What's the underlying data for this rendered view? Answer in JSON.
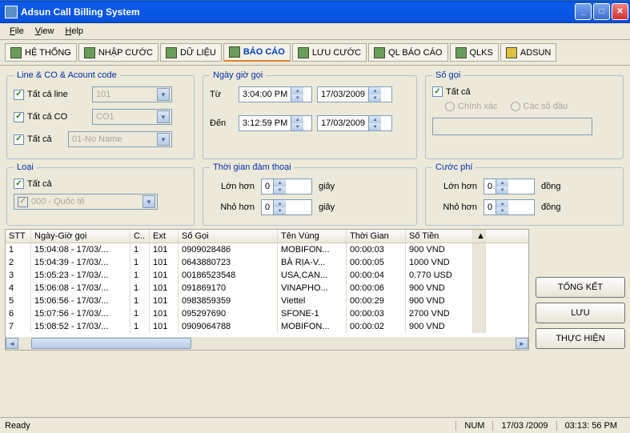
{
  "window": {
    "title": "Adsun Call Billing System"
  },
  "menu": {
    "file": "File",
    "view": "View",
    "help": "Help"
  },
  "tabs": [
    {
      "label": "HỆ THỐNG"
    },
    {
      "label": "NHẬP CƯỚC"
    },
    {
      "label": "DỮ LIỆU"
    },
    {
      "label": "BÁO CÁO"
    },
    {
      "label": "LƯU CƯỚC"
    },
    {
      "label": "QL BÁO CÁO"
    },
    {
      "label": "QLKS"
    },
    {
      "label": "ADSUN"
    }
  ],
  "group_lineco": {
    "legend": "Line & CO & Acount code",
    "all_line": "Tất cả line",
    "line_combo": "101",
    "all_co": "Tất cả CO",
    "co_combo": "CO1",
    "all_acc": "Tất cả",
    "acc_combo": "01-No Name"
  },
  "group_datetime": {
    "legend": "Ngày giờ gọi",
    "from": "Từ",
    "from_time": "3:04:00 PM",
    "from_date": "17/03/2009",
    "to": "Đến",
    "to_time": "3:12:59 PM",
    "to_date": "17/03/2009"
  },
  "group_number": {
    "legend": "Số gọi",
    "all": "Tất cả",
    "exact": "Chính xác",
    "prefix": "Các số đầu"
  },
  "group_type": {
    "legend": "Loại",
    "all": "Tất cả",
    "combo": "000 - Quốc tế"
  },
  "group_duration": {
    "legend": "Thời gian đàm thoại",
    "gt": "Lớn hơn",
    "lt": "Nhỏ hơn",
    "gt_val": "0",
    "lt_val": "0",
    "unit": "giây"
  },
  "group_cost": {
    "legend": "Cước phí",
    "gt": "Lớn hơn",
    "lt": "Nhỏ hơn",
    "gt_val": "0",
    "lt_val": "0",
    "unit": "đồng"
  },
  "table": {
    "headers": [
      "STT",
      "Ngày-Giờ gọi",
      "C..",
      "Ext",
      "Số Gọi",
      "Tên Vùng",
      "Thời Gian",
      "Số Tiền"
    ],
    "rows": [
      [
        "1",
        "15:04:08 - 17/03/...",
        "1",
        "101",
        "0909028486",
        "MOBIFON...",
        "00:00:03",
        "900 VND"
      ],
      [
        "2",
        "15:04:39 - 17/03/...",
        "1",
        "101",
        "0643880723",
        "BÀ RỊA-V...",
        "00:00:05",
        "1000 VND"
      ],
      [
        "3",
        "15:05:23 - 17/03/...",
        "1",
        "101",
        "00186523548",
        "USA,CAN...",
        "00:00:04",
        "0.770 USD"
      ],
      [
        "4",
        "15:06:08 - 17/03/...",
        "1",
        "101",
        "091869170",
        "VINAPHO...",
        "00:00:06",
        "900 VND"
      ],
      [
        "5",
        "15:06:56 - 17/03/...",
        "1",
        "101",
        "0983859359",
        "Viettel",
        "00:00:29",
        "900 VND"
      ],
      [
        "6",
        "15:07:56 - 17/03/...",
        "1",
        "101",
        "095297690",
        "SFONE-1",
        "00:00:03",
        "2700 VND"
      ],
      [
        "7",
        "15:08:52 - 17/03/...",
        "1",
        "101",
        "0909064788",
        "MOBIFON...",
        "00:00:02",
        "900 VND"
      ]
    ]
  },
  "buttons": {
    "summary": "TỔNG KẾT",
    "save": "LƯU",
    "execute": "THỰC HIỆN"
  },
  "status": {
    "ready": "Ready",
    "num": "NUM",
    "date": "17/03 /2009",
    "time": "03:13: 56 PM"
  }
}
